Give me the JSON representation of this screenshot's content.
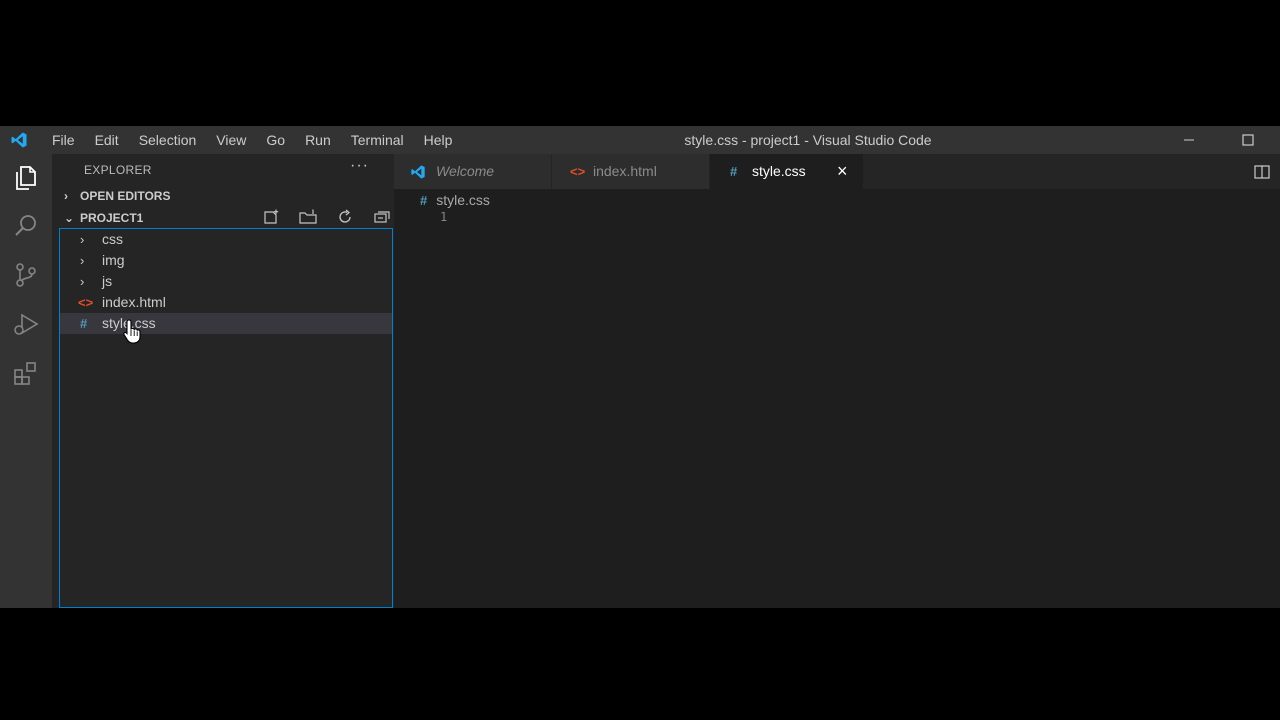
{
  "window": {
    "title": "style.css - project1 - Visual Studio Code",
    "menu": [
      "File",
      "Edit",
      "Selection",
      "View",
      "Go",
      "Run",
      "Terminal",
      "Help"
    ],
    "controls": [
      "minimize-icon",
      "maximize-icon"
    ]
  },
  "activity_bar": {
    "items": [
      "explorer-icon",
      "search-icon",
      "source-control-icon",
      "run-debug-icon",
      "extensions-icon"
    ],
    "active": "explorer-icon"
  },
  "sidebar": {
    "header": "EXPLORER",
    "more": "···",
    "open_editors_label": "OPEN EDITORS",
    "project_label": "PROJECT1",
    "project_actions": [
      "new-file-icon",
      "new-folder-icon",
      "refresh-icon",
      "collapse-all-icon"
    ],
    "tree": [
      {
        "label": "css",
        "type": "folder"
      },
      {
        "label": "img",
        "type": "folder"
      },
      {
        "label": "js",
        "type": "folder"
      },
      {
        "label": "index.html",
        "type": "html",
        "icon": "<>"
      },
      {
        "label": "style.css",
        "type": "css",
        "icon": "#",
        "selected": true
      }
    ]
  },
  "tabs": [
    {
      "label": "Welcome",
      "icon": "vscode-icon",
      "active": false,
      "italic": true
    },
    {
      "label": "index.html",
      "icon": "<>",
      "active": false
    },
    {
      "label": "style.css",
      "icon": "#",
      "active": true,
      "close": "×"
    }
  ],
  "editor": {
    "breadcrumb_icon": "#",
    "breadcrumb": "style.css",
    "line_numbers": [
      "1"
    ]
  },
  "colors": {
    "accent": "#007acc",
    "focus_border": "#007fd4",
    "html_icon": "#e44d26",
    "css_icon": "#519aba",
    "vscode_logo": "#23a9f2"
  }
}
